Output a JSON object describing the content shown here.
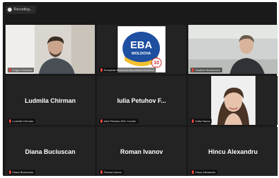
{
  "recording": {
    "label": "Recording..."
  },
  "participants": [
    {
      "name_tag": "Eugen Gorincioi",
      "display_name": ""
    },
    {
      "name_tag": "European Business Association Moldova",
      "display_name": ""
    },
    {
      "name_tag": "Vladimir Botnaresco",
      "display_name": ""
    },
    {
      "name_tag": "Ludmila Chirman",
      "display_name": "Ludmila Chirman"
    },
    {
      "name_tag": "Iulia Petuhov-DHL Courier",
      "display_name": "Iulia Petuhov F..."
    },
    {
      "name_tag": "Sofia Savca",
      "display_name": ""
    },
    {
      "name_tag": "Diana Buciuscan",
      "display_name": "Diana Buciuscan"
    },
    {
      "name_tag": "Roman Ivanov",
      "display_name": "Roman Ivanov"
    },
    {
      "name_tag": "Hincu Alexandru",
      "display_name": "Hincu Alexandru"
    }
  ],
  "eba_logo": {
    "line1": "EBA",
    "line2": "MOLDOVA",
    "badge": "10",
    "badge_sub": "ani"
  },
  "colors": {
    "speaker_outline": "#d8e24a",
    "muted_mic": "#e0443a",
    "tile_bg": "#232323"
  }
}
